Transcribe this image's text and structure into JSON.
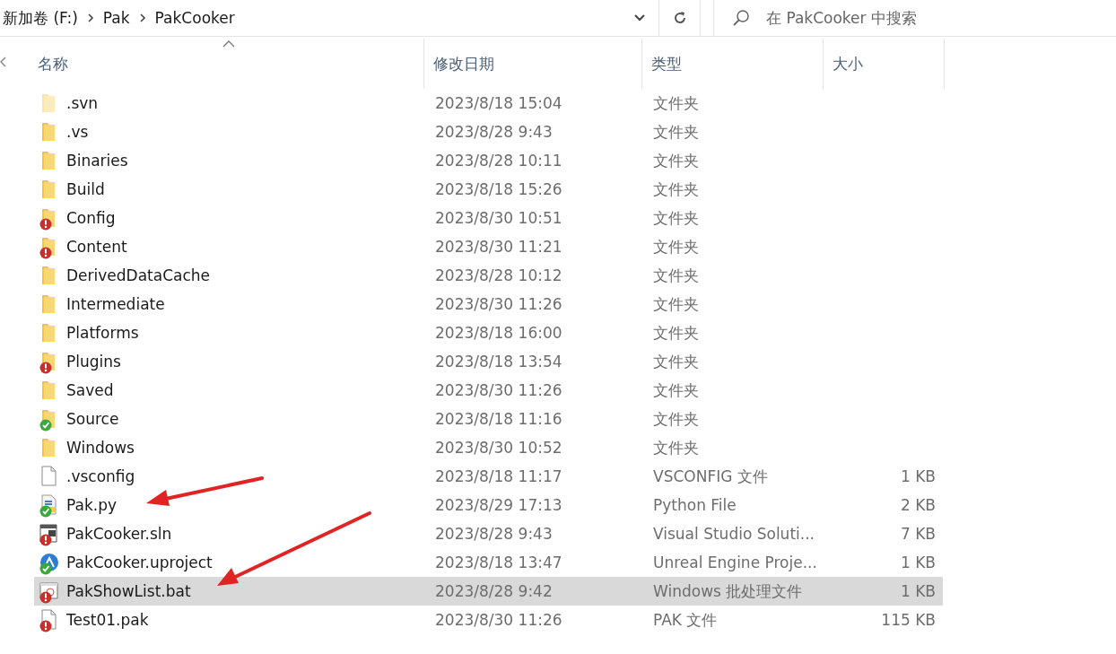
{
  "address_bar": {
    "path": [
      "新加卷 (F:)",
      "Pak",
      "PakCooker"
    ]
  },
  "search": {
    "placeholder": "在 PakCooker 中搜索"
  },
  "columns": [
    {
      "label": "名称",
      "sorted": true
    },
    {
      "label": "修改日期",
      "sorted": false
    },
    {
      "label": "类型",
      "sorted": false
    },
    {
      "label": "大小",
      "sorted": false
    }
  ],
  "rows": [
    {
      "name": ".svn",
      "date": "2023/8/18 15:04",
      "type": "文件夹",
      "kind": "folder",
      "faded": true,
      "selected": false
    },
    {
      "name": ".vs",
      "date": "2023/8/28 9:43",
      "type": "文件夹",
      "kind": "folder",
      "selected": false
    },
    {
      "name": "Binaries",
      "date": "2023/8/28 10:11",
      "type": "文件夹",
      "kind": "folder",
      "selected": false
    },
    {
      "name": "Build",
      "date": "2023/8/18 15:26",
      "type": "文件夹",
      "kind": "folder",
      "selected": false
    },
    {
      "name": "Config",
      "date": "2023/8/30 10:51",
      "type": "文件夹",
      "kind": "folder",
      "conflict": true,
      "selected": false
    },
    {
      "name": "Content",
      "date": "2023/8/30 11:21",
      "type": "文件夹",
      "kind": "folder",
      "conflict": true,
      "selected": false
    },
    {
      "name": "DerivedDataCache",
      "date": "2023/8/28 10:12",
      "type": "文件夹",
      "kind": "folder",
      "selected": false
    },
    {
      "name": "Intermediate",
      "date": "2023/8/30 11:26",
      "type": "文件夹",
      "kind": "folder",
      "selected": false
    },
    {
      "name": "Platforms",
      "date": "2023/8/18 16:00",
      "type": "文件夹",
      "kind": "folder",
      "selected": false
    },
    {
      "name": "Plugins",
      "date": "2023/8/18 13:54",
      "type": "文件夹",
      "kind": "folder",
      "conflict": true,
      "selected": false
    },
    {
      "name": "Saved",
      "date": "2023/8/30 11:26",
      "type": "文件夹",
      "kind": "folder",
      "selected": false
    },
    {
      "name": "Source",
      "date": "2023/8/18 11:16",
      "type": "文件夹",
      "kind": "folder",
      "synced": true,
      "selected": false
    },
    {
      "name": "Windows",
      "date": "2023/8/30 10:52",
      "type": "文件夹",
      "kind": "folder",
      "selected": false
    },
    {
      "name": ".vsconfig",
      "date": "2023/8/18 11:17",
      "type": "VSCONFIG 文件",
      "size": "1 KB",
      "kind": "file",
      "selected": false
    },
    {
      "name": "Pak.py",
      "date": "2023/8/29 17:13",
      "type": "Python File",
      "size": "2 KB",
      "kind": "python",
      "synced": true,
      "selected": false
    },
    {
      "name": "PakCooker.sln",
      "date": "2023/8/28 9:43",
      "type": "Visual Studio Soluti...",
      "size": "7 KB",
      "kind": "solution",
      "conflict": true,
      "selected": false
    },
    {
      "name": "PakCooker.uproject",
      "date": "2023/8/18 13:47",
      "type": "Unreal Engine Proje...",
      "size": "1 KB",
      "kind": "project",
      "synced": true,
      "selected": false
    },
    {
      "name": "PakShowList.bat",
      "date": "2023/8/28 9:42",
      "type": "Windows 批处理文件",
      "size": "1 KB",
      "kind": "batch",
      "conflict": true,
      "selected": true
    },
    {
      "name": "Test01.pak",
      "date": "2023/8/30 11:26",
      "type": "PAK 文件",
      "size": "115 KB",
      "kind": "file",
      "conflict": true,
      "selected": false
    }
  ]
}
